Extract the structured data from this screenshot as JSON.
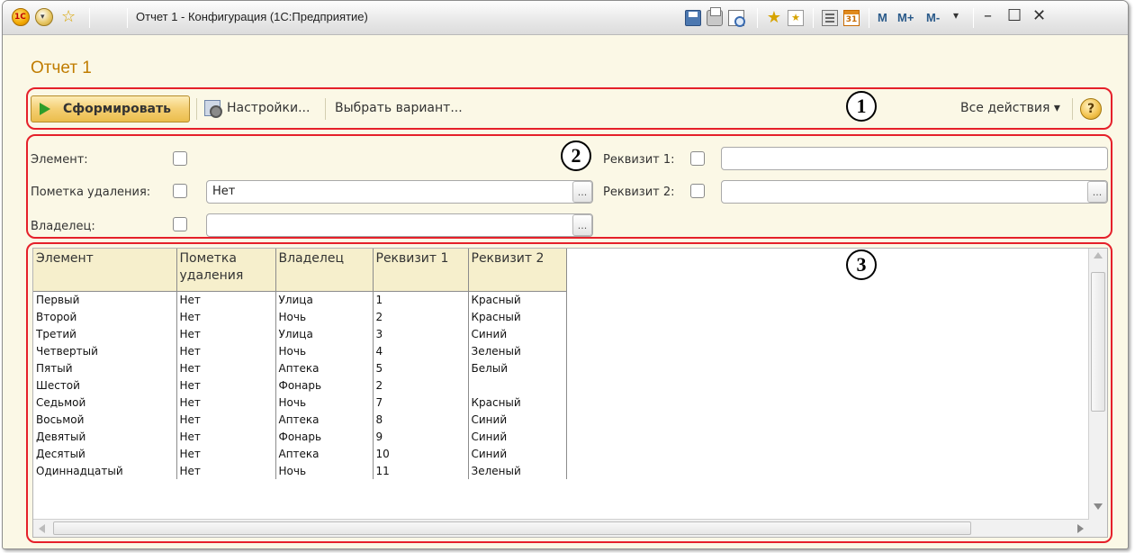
{
  "window": {
    "title": "Отчет 1 - Конфигурация  (1С:Предприятие)",
    "logo_text": "1С",
    "memory_buttons": [
      "M",
      "M+",
      "M-"
    ]
  },
  "page": {
    "title": "Отчет 1"
  },
  "toolbar": {
    "generate_label": "Сформировать",
    "settings_label": "Настройки...",
    "choose_variant_label": "Выбрать вариант...",
    "all_actions_label": "Все действия ▾",
    "help_label": "?"
  },
  "filters": {
    "element_label": "Элемент:",
    "deletion_mark_label": "Пометка удаления:",
    "deletion_mark_value": "Нет",
    "owner_label": "Владелец:",
    "owner_value": "",
    "attr1_label": "Реквизит 1:",
    "attr1_value": "",
    "attr2_label": "Реквизит 2:",
    "attr2_value": "",
    "ellipsis": "..."
  },
  "annotations": [
    "1",
    "2",
    "3"
  ],
  "table": {
    "columns": [
      "Элемент",
      "Пометка удаления",
      "Владелец",
      "Реквизит 1",
      "Реквизит 2"
    ],
    "rows": [
      [
        "Первый",
        "Нет",
        "Улица",
        "1",
        "Красный"
      ],
      [
        "Второй",
        "Нет",
        "Ночь",
        "2",
        "Красный"
      ],
      [
        "Третий",
        "Нет",
        "Улица",
        "3",
        "Синий"
      ],
      [
        "Четвертый",
        "Нет",
        "Ночь",
        "4",
        "Зеленый"
      ],
      [
        "Пятый",
        "Нет",
        "Аптека",
        "5",
        "Белый"
      ],
      [
        "Шестой",
        "Нет",
        "Фонарь",
        "2",
        ""
      ],
      [
        "Седьмой",
        "Нет",
        "Ночь",
        "7",
        "Красный"
      ],
      [
        "Восьмой",
        "Нет",
        "Аптека",
        "8",
        "Синий"
      ],
      [
        "Девятый",
        "Нет",
        "Фонарь",
        "9",
        "Синий"
      ],
      [
        "Десятый",
        "Нет",
        "Аптека",
        "10",
        "Синий"
      ],
      [
        "Одиннадцатый",
        "Нет",
        "Ночь",
        "11",
        "Зеленый"
      ]
    ]
  },
  "colors": {
    "annotation_border": "#e5202a",
    "header_bg": "#f6efcc",
    "title_color": "#c07c00",
    "window_bg": "#fbf8e6"
  }
}
